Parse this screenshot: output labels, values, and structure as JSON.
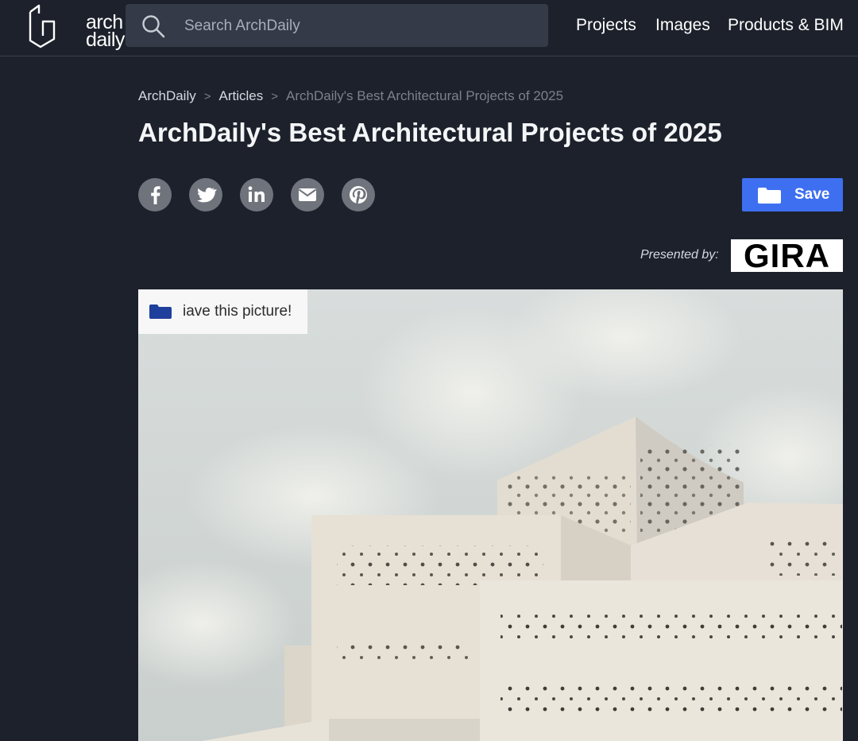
{
  "header": {
    "logo": {
      "line1": "arch",
      "line2": "daily"
    },
    "search": {
      "placeholder": "Search ArchDaily"
    },
    "nav": [
      {
        "label": "Projects"
      },
      {
        "label": "Images"
      },
      {
        "label": "Products & BIM"
      }
    ]
  },
  "breadcrumb": {
    "items": [
      {
        "label": "ArchDaily"
      },
      {
        "label": "Articles"
      },
      {
        "label": "ArchDaily's Best Architectural Projects of 2025"
      }
    ],
    "separator": ">"
  },
  "article": {
    "title": "ArchDaily's Best Architectural Projects of 2025"
  },
  "share": {
    "icons": [
      "facebook-icon",
      "twitter-icon",
      "linkedin-icon",
      "email-icon",
      "pinterest-icon"
    ]
  },
  "save": {
    "label": "Save"
  },
  "sponsor": {
    "presented_label": "Presented by:",
    "logo_text": "GIRA"
  },
  "image_overlay": {
    "save_picture_label": "iave this picture!"
  },
  "colors": {
    "page_background": "#1c212b",
    "accent": "#3e6ff1",
    "share_icon_bg": "#6f737b",
    "search_bg": "#343a47"
  }
}
